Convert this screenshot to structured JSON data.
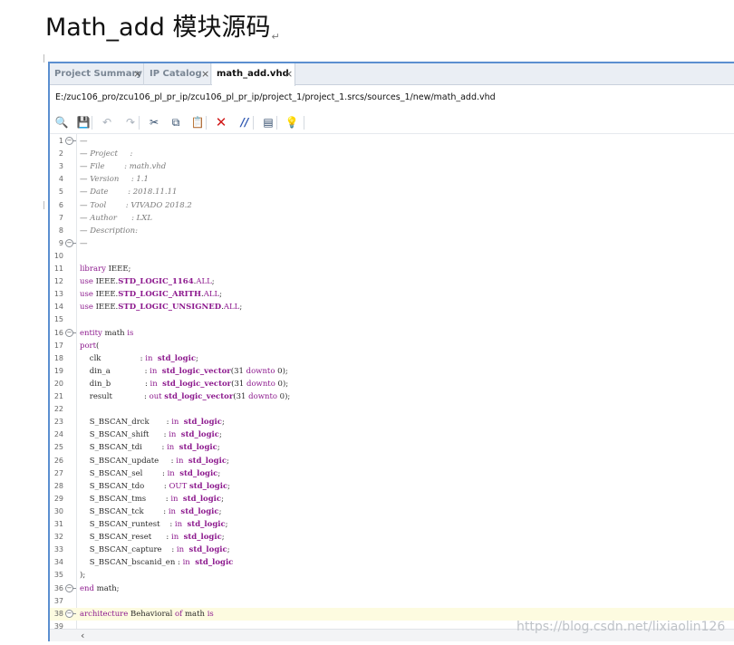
{
  "doc": {
    "title": "Math_add 模块源码",
    "para_mark": "↵"
  },
  "tabs": [
    {
      "label": "Project Summary",
      "close": "×"
    },
    {
      "label": "IP Catalog",
      "close": "×"
    },
    {
      "label": "math_add.vhd",
      "close": "×"
    }
  ],
  "path": "E:/zuc106_pro/zcu106_pl_pr_ip/zcu106_pl_pr_ip/project_1/project_1.srcs/sources_1/new/math_add.vhd",
  "toolbar": [
    {
      "name": "search-icon",
      "glyph": "🔍",
      "state": "enabled"
    },
    {
      "name": "save-icon",
      "glyph": "💾",
      "state": "disabled"
    },
    {
      "name": "undo-icon",
      "glyph": "↶",
      "state": "disabled"
    },
    {
      "name": "redo-icon",
      "glyph": "↷",
      "state": "disabled"
    },
    {
      "name": "cut-icon",
      "glyph": "✂",
      "state": "enabled"
    },
    {
      "name": "copy-icon",
      "glyph": "⧉",
      "state": "enabled"
    },
    {
      "name": "paste-icon",
      "glyph": "📋",
      "state": "enabled"
    },
    {
      "name": "delete-icon",
      "glyph": "✕",
      "state": "red"
    },
    {
      "name": "comment-icon",
      "glyph": "//",
      "state": "blue"
    },
    {
      "name": "block-icon",
      "glyph": "▤",
      "state": "enabled"
    },
    {
      "name": "lightbulb-icon",
      "glyph": "💡",
      "state": "enabled"
    }
  ],
  "colors": {
    "accent": "#5b8fd0",
    "keyword": "#8d1a8e",
    "comment": "#7a7a7a",
    "highlight": "#fdfbe0"
  },
  "code_lines": [
    {
      "n": "1",
      "fold": "−",
      "tokens": [
        [
          "c",
          "—"
        ]
      ]
    },
    {
      "n": "2",
      "tokens": [
        [
          "c",
          "— Project     :"
        ]
      ]
    },
    {
      "n": "3",
      "tokens": [
        [
          "c",
          "— File        : math.vhd"
        ]
      ]
    },
    {
      "n": "4",
      "tokens": [
        [
          "c",
          "— Version     : 1.1"
        ]
      ]
    },
    {
      "n": "5",
      "tokens": [
        [
          "c",
          "— Date        : 2018.11.11"
        ]
      ]
    },
    {
      "n": "6",
      "tokens": [
        [
          "c",
          "— Tool        : VIVADO 2018.2"
        ]
      ]
    },
    {
      "n": "7",
      "tokens": [
        [
          "c",
          "— Author      : LXL"
        ]
      ]
    },
    {
      "n": "8",
      "tokens": [
        [
          "c",
          "— Description:"
        ]
      ]
    },
    {
      "n": "9",
      "fold": "−",
      "tokens": [
        [
          "c",
          "—"
        ]
      ]
    },
    {
      "n": "10",
      "tokens": []
    },
    {
      "n": "11",
      "tokens": [
        [
          "k",
          "library"
        ],
        [
          "i",
          " IEEE;"
        ]
      ]
    },
    {
      "n": "12",
      "tokens": [
        [
          "k",
          "use"
        ],
        [
          "i",
          " IEEE."
        ],
        [
          "t",
          "STD_LOGIC_1164"
        ],
        [
          "i",
          "."
        ],
        [
          "k",
          "ALL"
        ],
        [
          "i",
          ";"
        ]
      ]
    },
    {
      "n": "13",
      "tokens": [
        [
          "k",
          "use"
        ],
        [
          "i",
          " IEEE."
        ],
        [
          "t",
          "STD_LOGIC_ARITH"
        ],
        [
          "i",
          "."
        ],
        [
          "k",
          "ALL"
        ],
        [
          "i",
          ";"
        ]
      ]
    },
    {
      "n": "14",
      "tokens": [
        [
          "k",
          "use"
        ],
        [
          "i",
          " IEEE."
        ],
        [
          "t",
          "STD_LOGIC_UNSIGNED"
        ],
        [
          "i",
          "."
        ],
        [
          "k",
          "ALL"
        ],
        [
          "i",
          ";"
        ]
      ]
    },
    {
      "n": "15",
      "tokens": []
    },
    {
      "n": "16",
      "fold": "−",
      "tokens": [
        [
          "k",
          "entity"
        ],
        [
          "i",
          " math "
        ],
        [
          "k",
          "is"
        ]
      ]
    },
    {
      "n": "17",
      "tokens": [
        [
          "k",
          "port"
        ],
        [
          "i",
          "("
        ]
      ]
    },
    {
      "n": "18",
      "tokens": [
        [
          "i",
          "    clk                "
        ],
        [
          "i",
          ": "
        ],
        [
          "k",
          "in"
        ],
        [
          "i",
          "  "
        ],
        [
          "t",
          "std_logic"
        ],
        [
          "i",
          ";"
        ]
      ]
    },
    {
      "n": "19",
      "tokens": [
        [
          "i",
          "    din_a              "
        ],
        [
          "i",
          ": "
        ],
        [
          "k",
          "in"
        ],
        [
          "i",
          "  "
        ],
        [
          "t",
          "std_logic_vector"
        ],
        [
          "i",
          "(31 "
        ],
        [
          "k",
          "downto"
        ],
        [
          "i",
          " 0);"
        ]
      ]
    },
    {
      "n": "20",
      "tokens": [
        [
          "i",
          "    din_b              "
        ],
        [
          "i",
          ": "
        ],
        [
          "k",
          "in"
        ],
        [
          "i",
          "  "
        ],
        [
          "t",
          "std_logic_vector"
        ],
        [
          "i",
          "(31 "
        ],
        [
          "k",
          "downto"
        ],
        [
          "i",
          " 0);"
        ]
      ]
    },
    {
      "n": "21",
      "tokens": [
        [
          "i",
          "    result             "
        ],
        [
          "i",
          ": "
        ],
        [
          "k",
          "out"
        ],
        [
          "i",
          " "
        ],
        [
          "t",
          "std_logic_vector"
        ],
        [
          "i",
          "(31 "
        ],
        [
          "k",
          "downto"
        ],
        [
          "i",
          " 0);"
        ]
      ]
    },
    {
      "n": "22",
      "tokens": []
    },
    {
      "n": "23",
      "tokens": [
        [
          "i",
          "    S_BSCAN_drck       "
        ],
        [
          "i",
          ": "
        ],
        [
          "k",
          "in"
        ],
        [
          "i",
          "  "
        ],
        [
          "t",
          "std_logic"
        ],
        [
          "i",
          ";"
        ]
      ]
    },
    {
      "n": "24",
      "tokens": [
        [
          "i",
          "    S_BSCAN_shift      "
        ],
        [
          "i",
          ": "
        ],
        [
          "k",
          "in"
        ],
        [
          "i",
          "  "
        ],
        [
          "t",
          "std_logic"
        ],
        [
          "i",
          ";"
        ]
      ]
    },
    {
      "n": "25",
      "tokens": [
        [
          "i",
          "    S_BSCAN_tdi        "
        ],
        [
          "i",
          ": "
        ],
        [
          "k",
          "in"
        ],
        [
          "i",
          "  "
        ],
        [
          "t",
          "std_logic"
        ],
        [
          "i",
          ";"
        ]
      ]
    },
    {
      "n": "26",
      "tokens": [
        [
          "i",
          "    S_BSCAN_update     "
        ],
        [
          "i",
          ": "
        ],
        [
          "k",
          "in"
        ],
        [
          "i",
          "  "
        ],
        [
          "t",
          "std_logic"
        ],
        [
          "i",
          ";"
        ]
      ]
    },
    {
      "n": "27",
      "tokens": [
        [
          "i",
          "    S_BSCAN_sel        "
        ],
        [
          "i",
          ": "
        ],
        [
          "k",
          "in"
        ],
        [
          "i",
          "  "
        ],
        [
          "t",
          "std_logic"
        ],
        [
          "i",
          ";"
        ]
      ]
    },
    {
      "n": "28",
      "tokens": [
        [
          "i",
          "    S_BSCAN_tdo        "
        ],
        [
          "i",
          ": "
        ],
        [
          "k",
          "OUT"
        ],
        [
          "i",
          " "
        ],
        [
          "t",
          "std_logic"
        ],
        [
          "i",
          ";"
        ]
      ]
    },
    {
      "n": "29",
      "tokens": [
        [
          "i",
          "    S_BSCAN_tms        "
        ],
        [
          "i",
          ": "
        ],
        [
          "k",
          "in"
        ],
        [
          "i",
          "  "
        ],
        [
          "t",
          "std_logic"
        ],
        [
          "i",
          ";"
        ]
      ]
    },
    {
      "n": "30",
      "tokens": [
        [
          "i",
          "    S_BSCAN_tck        "
        ],
        [
          "i",
          ": "
        ],
        [
          "k",
          "in"
        ],
        [
          "i",
          "  "
        ],
        [
          "t",
          "std_logic"
        ],
        [
          "i",
          ";"
        ]
      ]
    },
    {
      "n": "31",
      "tokens": [
        [
          "i",
          "    S_BSCAN_runtest    "
        ],
        [
          "i",
          ": "
        ],
        [
          "k",
          "in"
        ],
        [
          "i",
          "  "
        ],
        [
          "t",
          "std_logic"
        ],
        [
          "i",
          ";"
        ]
      ]
    },
    {
      "n": "32",
      "tokens": [
        [
          "i",
          "    S_BSCAN_reset      "
        ],
        [
          "i",
          ": "
        ],
        [
          "k",
          "in"
        ],
        [
          "i",
          "  "
        ],
        [
          "t",
          "std_logic"
        ],
        [
          "i",
          ";"
        ]
      ]
    },
    {
      "n": "33",
      "tokens": [
        [
          "i",
          "    S_BSCAN_capture    "
        ],
        [
          "i",
          ": "
        ],
        [
          "k",
          "in"
        ],
        [
          "i",
          "  "
        ],
        [
          "t",
          "std_logic"
        ],
        [
          "i",
          ";"
        ]
      ]
    },
    {
      "n": "34",
      "tokens": [
        [
          "i",
          "    S_BSCAN_bscanid_en "
        ],
        [
          "i",
          ": "
        ],
        [
          "k",
          "in"
        ],
        [
          "i",
          "  "
        ],
        [
          "t",
          "std_logic"
        ]
      ]
    },
    {
      "n": "35",
      "tokens": [
        [
          "i",
          ");"
        ]
      ]
    },
    {
      "n": "36",
      "fold": "−",
      "tokens": [
        [
          "k",
          "end"
        ],
        [
          "i",
          " math;"
        ]
      ]
    },
    {
      "n": "37",
      "tokens": []
    },
    {
      "n": "38",
      "fold": "−",
      "highlight": true,
      "tokens": [
        [
          "k",
          "architecture"
        ],
        [
          "i",
          " Behavioral "
        ],
        [
          "k",
          "of"
        ],
        [
          "i",
          " math "
        ],
        [
          "k",
          "is"
        ]
      ]
    },
    {
      "n": "39",
      "tokens": []
    }
  ],
  "scroll": {
    "left_arrow": "‹"
  },
  "watermark": "https://blog.csdn.net/lixiaolin126"
}
